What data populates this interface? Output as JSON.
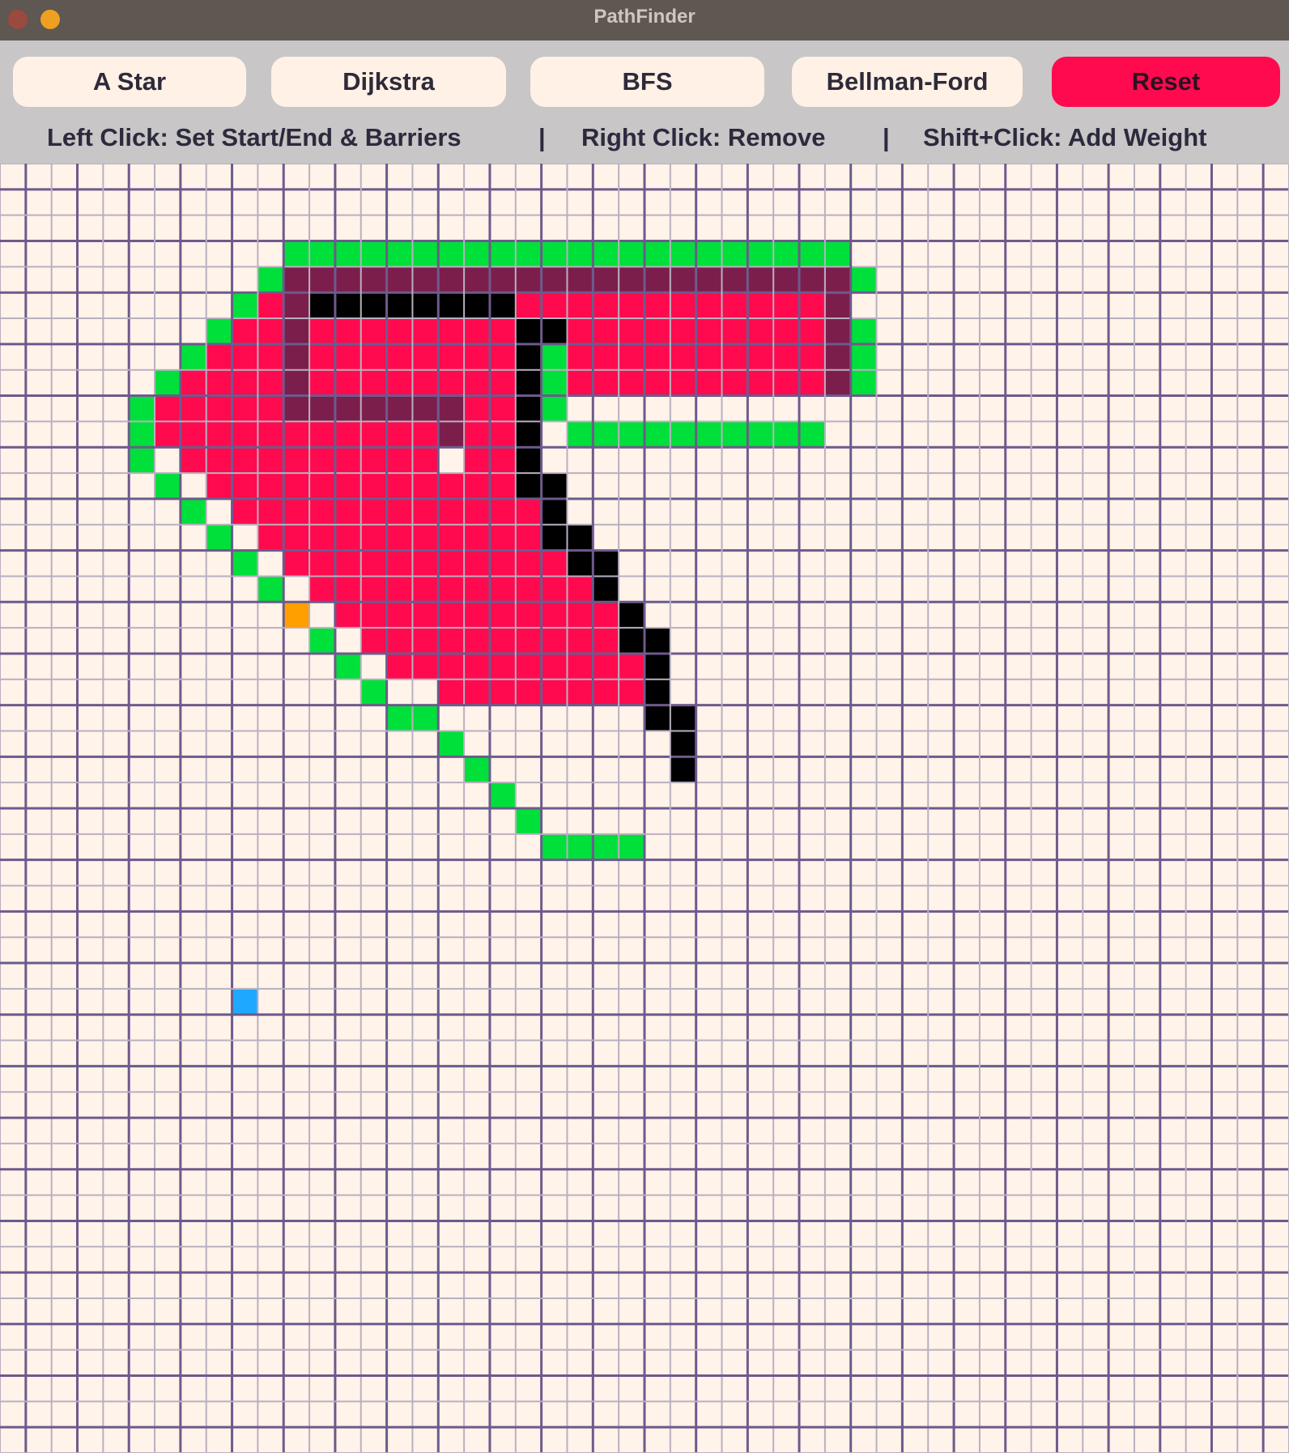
{
  "window": {
    "title": "PathFinder"
  },
  "toolbar": {
    "buttons": [
      {
        "label": "A Star"
      },
      {
        "label": "Dijkstra"
      },
      {
        "label": "BFS"
      },
      {
        "label": "Bellman-Ford"
      },
      {
        "label": "Reset"
      }
    ]
  },
  "instructions": {
    "left": "Left Click: Set Start/End & Barriers",
    "sep1": "|",
    "right": "Right Click: Remove",
    "sep2": "|",
    "shift": "Shift+Click: Add Weight"
  },
  "grid": {
    "columns": 50,
    "rows": 50,
    "legend": {
      "closed": "#ff0a4e",
      "open": "#00e03a",
      "path": "#7c1e4b",
      "barrier": "#000000",
      "start": "#ff9f00",
      "end": "#1fa8ff",
      "empty": "#fff3ea",
      "line_major": "#6d5a8c",
      "line_minor": "#b9b0c0"
    },
    "start": [
      17,
      11
    ],
    "end": [
      32,
      9
    ],
    "closed_runs": [
      [
        5,
        10,
        11
      ],
      [
        5,
        20,
        31
      ],
      [
        6,
        9,
        11
      ],
      [
        6,
        12,
        19
      ],
      [
        6,
        22,
        31
      ],
      [
        7,
        8,
        11
      ],
      [
        7,
        12,
        19
      ],
      [
        7,
        22,
        31
      ],
      [
        8,
        7,
        11
      ],
      [
        8,
        12,
        19
      ],
      [
        8,
        22,
        31
      ],
      [
        9,
        6,
        11
      ],
      [
        9,
        12,
        16
      ],
      [
        9,
        18,
        19
      ],
      [
        10,
        6,
        16
      ],
      [
        10,
        18,
        19
      ],
      [
        11,
        7,
        16
      ],
      [
        11,
        18,
        19
      ],
      [
        12,
        8,
        19
      ],
      [
        13,
        9,
        20
      ],
      [
        14,
        10,
        20
      ],
      [
        15,
        11,
        21
      ],
      [
        16,
        12,
        22
      ],
      [
        17,
        13,
        23
      ],
      [
        18,
        14,
        24
      ],
      [
        19,
        15,
        24
      ],
      [
        20,
        17,
        24
      ]
    ],
    "open_cells": [
      [
        3,
        11
      ],
      [
        3,
        12
      ],
      [
        3,
        13
      ],
      [
        3,
        14
      ],
      [
        3,
        15
      ],
      [
        3,
        16
      ],
      [
        3,
        17
      ],
      [
        3,
        18
      ],
      [
        3,
        19
      ],
      [
        3,
        20
      ],
      [
        3,
        21
      ],
      [
        3,
        22
      ],
      [
        3,
        23
      ],
      [
        3,
        24
      ],
      [
        3,
        25
      ],
      [
        3,
        26
      ],
      [
        3,
        27
      ],
      [
        3,
        28
      ],
      [
        3,
        29
      ],
      [
        3,
        30
      ],
      [
        3,
        31
      ],
      [
        3,
        32
      ],
      [
        4,
        10
      ],
      [
        4,
        33
      ],
      [
        5,
        9
      ],
      [
        6,
        8
      ],
      [
        6,
        33
      ],
      [
        7,
        7
      ],
      [
        7,
        21
      ],
      [
        7,
        33
      ],
      [
        8,
        6
      ],
      [
        8,
        21
      ],
      [
        8,
        33
      ],
      [
        9,
        5
      ],
      [
        9,
        21
      ],
      [
        10,
        5
      ],
      [
        10,
        22
      ],
      [
        10,
        23
      ],
      [
        10,
        24
      ],
      [
        10,
        25
      ],
      [
        10,
        26
      ],
      [
        10,
        27
      ],
      [
        10,
        28
      ],
      [
        10,
        29
      ],
      [
        10,
        30
      ],
      [
        10,
        31
      ],
      [
        11,
        5
      ],
      [
        12,
        6
      ],
      [
        13,
        7
      ],
      [
        14,
        8
      ],
      [
        15,
        9
      ],
      [
        16,
        10
      ],
      [
        17,
        11
      ],
      [
        18,
        12
      ],
      [
        19,
        13
      ],
      [
        20,
        14
      ],
      [
        21,
        15
      ],
      [
        21,
        16
      ],
      [
        22,
        17
      ],
      [
        23,
        18
      ],
      [
        24,
        19
      ],
      [
        25,
        20
      ],
      [
        26,
        21
      ],
      [
        26,
        22
      ],
      [
        26,
        23
      ],
      [
        26,
        24
      ]
    ],
    "path_cells": [
      [
        4,
        11
      ],
      [
        4,
        12
      ],
      [
        4,
        13
      ],
      [
        4,
        14
      ],
      [
        4,
        15
      ],
      [
        4,
        16
      ],
      [
        4,
        17
      ],
      [
        4,
        18
      ],
      [
        4,
        19
      ],
      [
        4,
        20
      ],
      [
        4,
        21
      ],
      [
        4,
        22
      ],
      [
        4,
        23
      ],
      [
        4,
        24
      ],
      [
        4,
        25
      ],
      [
        4,
        26
      ],
      [
        4,
        27
      ],
      [
        4,
        28
      ],
      [
        4,
        29
      ],
      [
        4,
        30
      ],
      [
        4,
        31
      ],
      [
        4,
        32
      ],
      [
        5,
        11
      ],
      [
        5,
        32
      ],
      [
        6,
        11
      ],
      [
        6,
        32
      ],
      [
        7,
        11
      ],
      [
        7,
        32
      ],
      [
        8,
        11
      ],
      [
        8,
        32
      ],
      [
        9,
        11
      ],
      [
        9,
        12
      ],
      [
        9,
        13
      ],
      [
        9,
        14
      ],
      [
        9,
        15
      ],
      [
        9,
        16
      ],
      [
        9,
        17
      ],
      [
        10,
        17
      ]
    ],
    "barrier_cells": [
      [
        5,
        12
      ],
      [
        5,
        13
      ],
      [
        5,
        14
      ],
      [
        5,
        15
      ],
      [
        5,
        16
      ],
      [
        5,
        17
      ],
      [
        5,
        18
      ],
      [
        5,
        19
      ],
      [
        6,
        20
      ],
      [
        6,
        21
      ],
      [
        7,
        20
      ],
      [
        8,
        20
      ],
      [
        9,
        20
      ],
      [
        10,
        20
      ],
      [
        11,
        20
      ],
      [
        12,
        20
      ],
      [
        12,
        21
      ],
      [
        13,
        21
      ],
      [
        14,
        21
      ],
      [
        14,
        22
      ],
      [
        15,
        22
      ],
      [
        15,
        23
      ],
      [
        16,
        23
      ],
      [
        17,
        24
      ],
      [
        18,
        24
      ],
      [
        18,
        25
      ],
      [
        19,
        25
      ],
      [
        20,
        25
      ],
      [
        21,
        25
      ],
      [
        21,
        26
      ],
      [
        22,
        26
      ],
      [
        23,
        26
      ]
    ]
  }
}
